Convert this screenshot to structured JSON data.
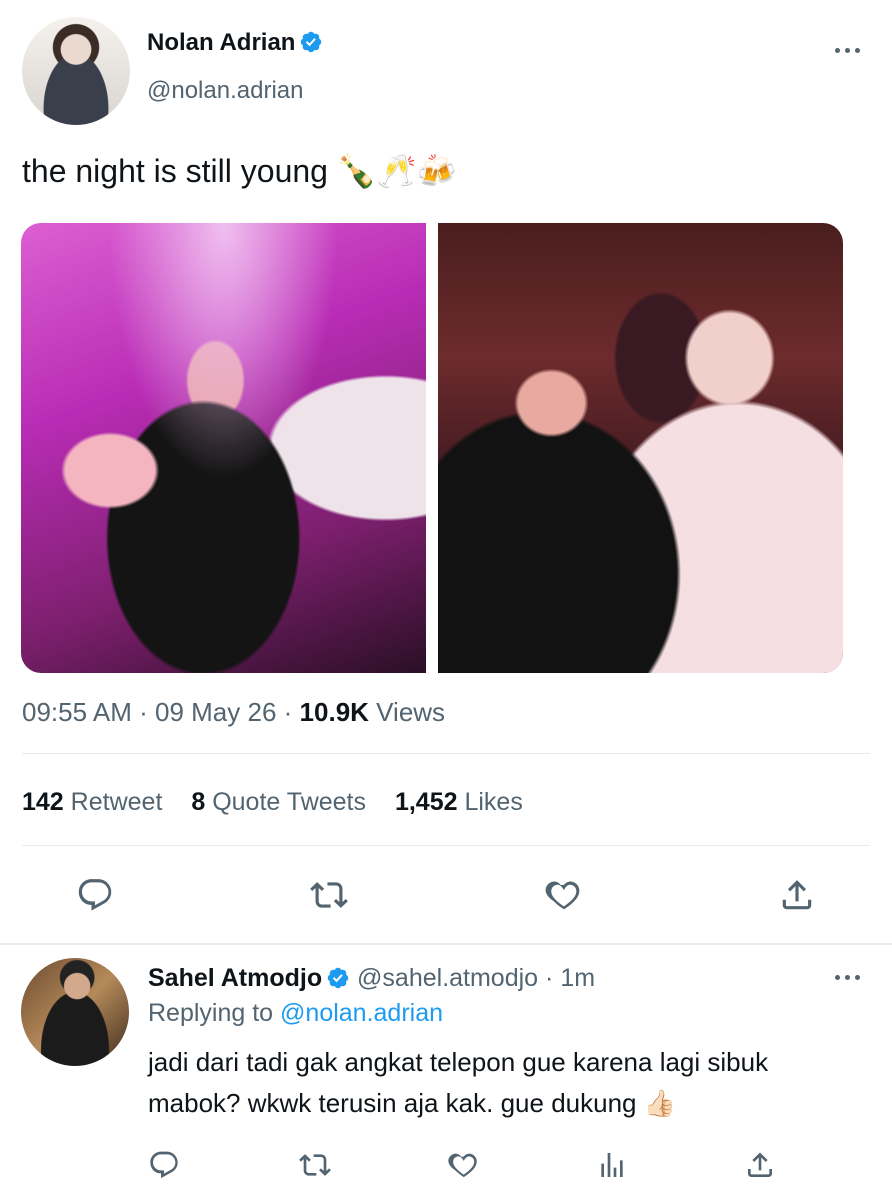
{
  "tweet": {
    "author_name": "Nolan Adrian",
    "author_handle": "@nolan.adrian",
    "text": "the night is still young 🍾🥂🍻",
    "time": "09:55 AM",
    "date": "09 May 26",
    "views_count": "10.9K",
    "views_label": "Views",
    "separator": "·"
  },
  "stats": {
    "retweets_count": "142",
    "retweets_label": "Retweet",
    "quotes_count": "8",
    "quotes_label": "Quote Tweets",
    "likes_count": "1,452",
    "likes_label": "Likes"
  },
  "reply": {
    "author_name": "Sahel Atmodjo",
    "author_handle": "@sahel.atmodjo",
    "time_ago": "1m",
    "separator": "·",
    "replying_prefix": "Replying to",
    "replying_to": "@nolan.adrian",
    "text": "jadi dari tadi gak angkat telepon gue karena lagi sibuk mabok? wkwk terusin aja kak. gue dukung 👍🏻"
  },
  "colors": {
    "verified": "#1d9bf0",
    "icon": "#536471",
    "text": "#0f1419",
    "link": "#1d9bf0"
  },
  "icons": [
    "verified-icon",
    "more-icon",
    "reply-icon",
    "retweet-icon",
    "like-icon",
    "share-icon",
    "views-icon"
  ]
}
